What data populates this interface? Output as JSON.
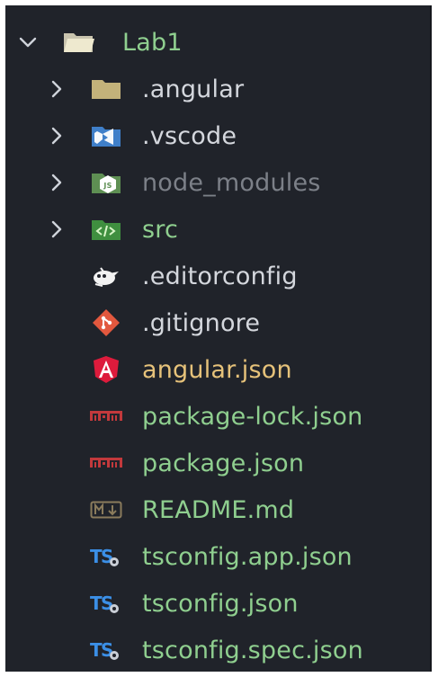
{
  "root": {
    "label": "Lab1",
    "color": "#8fcf8f"
  },
  "items": [
    {
      "label": ".angular",
      "kind": "folder",
      "icon": "folder-icon",
      "color": "#d4d7dd"
    },
    {
      "label": ".vscode",
      "kind": "folder",
      "icon": "vscode-folder-icon",
      "color": "#d4d7dd"
    },
    {
      "label": "node_modules",
      "kind": "folder",
      "icon": "node-folder-icon",
      "color": "#7c8088"
    },
    {
      "label": "src",
      "kind": "folder",
      "icon": "src-folder-icon",
      "color": "#8fcf8f"
    },
    {
      "label": ".editorconfig",
      "kind": "file",
      "icon": "editorconfig-icon",
      "color": "#d4d7dd"
    },
    {
      "label": ".gitignore",
      "kind": "file",
      "icon": "git-icon",
      "color": "#d4d7dd"
    },
    {
      "label": "angular.json",
      "kind": "file",
      "icon": "angular-icon",
      "color": "#e6c27a"
    },
    {
      "label": "package-lock.json",
      "kind": "file",
      "icon": "npm-icon",
      "color": "#8fcf8f"
    },
    {
      "label": "package.json",
      "kind": "file",
      "icon": "npm-icon",
      "color": "#8fcf8f"
    },
    {
      "label": "README.md",
      "kind": "file",
      "icon": "markdown-icon",
      "color": "#8fcf8f"
    },
    {
      "label": "tsconfig.app.json",
      "kind": "file",
      "icon": "tsconfig-icon",
      "color": "#8fcf8f"
    },
    {
      "label": "tsconfig.json",
      "kind": "file",
      "icon": "tsconfig-icon",
      "color": "#8fcf8f"
    },
    {
      "label": "tsconfig.spec.json",
      "kind": "file",
      "icon": "tsconfig-icon",
      "color": "#8fcf8f"
    }
  ]
}
